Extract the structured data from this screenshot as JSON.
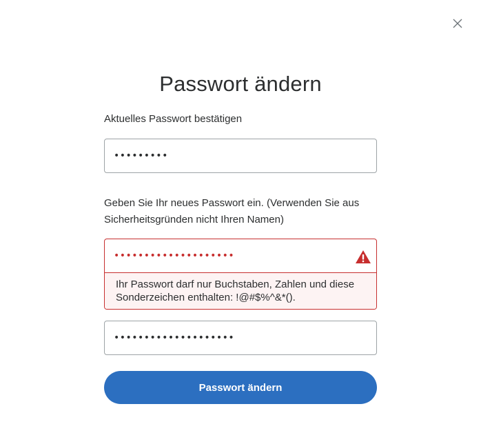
{
  "dialog": {
    "title": "Passwort ändern",
    "close_icon": "close-icon"
  },
  "current_password": {
    "label": "Aktuelles Passwort bestätigen",
    "value": "•••••••••"
  },
  "new_password": {
    "label": "Geben Sie Ihr neues Passwort ein. (Verwenden Sie aus Sicherheitsgründen nicht Ihren Namen)",
    "value": "••••••••••••••••••••",
    "warning_icon": "warning-icon",
    "error_message": "Ihr Passwort darf nur Buchstaben, Zahlen und diese Sonderzeichen enthalten: !@#$%^&*()."
  },
  "confirm_password": {
    "value": "••••••••••••••••••••"
  },
  "submit": {
    "label": "Passwort ändern"
  },
  "colors": {
    "error": "#c72e2e",
    "error_background": "#fdf3f3",
    "primary_button": "#2c6fc0",
    "border": "#9da3a6"
  }
}
